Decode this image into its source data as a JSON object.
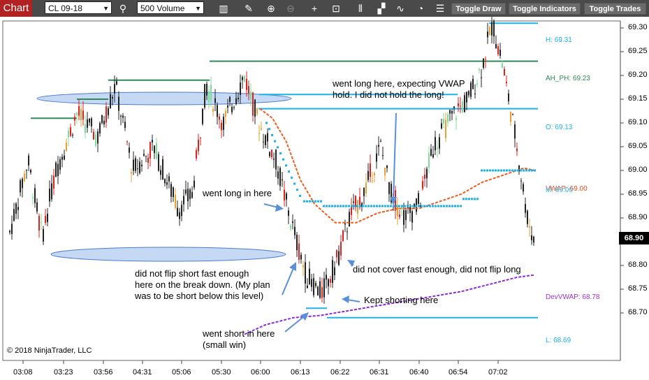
{
  "toolbar": {
    "title": "Chart",
    "instrument": "CL 09-18",
    "interval": "500 Volume",
    "buttons": [
      "Toggle Draw",
      "Toggle Indicators",
      "Toggle Trades"
    ],
    "icons": [
      "bars-icon",
      "pencil-icon",
      "zoom-in-icon",
      "zoom-out-icon",
      "crosshair-icon",
      "data-box-icon",
      "bar-type-icon",
      "drawing-tools-icon",
      "indicators-icon",
      "strategies-icon",
      "properties-icon"
    ]
  },
  "chart_data": {
    "type": "candlestick",
    "y_axis": {
      "range": [
        68.66,
        69.35
      ],
      "ticks": [
        "69.30",
        "69.25",
        "69.20",
        "69.15",
        "69.10",
        "69.05",
        "69.00",
        "68.95",
        "68.90",
        "68.85",
        "68.80",
        "68.75",
        "68.70"
      ]
    },
    "x_axis": {
      "ticks": [
        "03:08",
        "03:23",
        "03:56",
        "04:31",
        "05:06",
        "05:30",
        "06:00",
        "06:13",
        "06:22",
        "06:31",
        "06:40",
        "06:54",
        "07:02"
      ]
    },
    "last_price": "68.90",
    "price_lines": [
      {
        "label": "H: 69.31",
        "value": 69.31
      },
      {
        "label": "AH_PH: 69.23",
        "value": 69.23
      },
      {
        "label": "O: 69.13",
        "value": 69.13
      },
      {
        "label": "L: 68.69",
        "value": 68.69
      }
    ],
    "right_labels": [
      {
        "text": "VWAP: 69.00",
        "value": 69.0,
        "color": "#e05020"
      },
      {
        "text": "M: 69.00",
        "value": 68.995,
        "color": "#33bbee"
      },
      {
        "text": "DevVWAP: 68.78",
        "value": 68.78,
        "color": "#9933cc"
      }
    ]
  },
  "annotations": [
    "went long here, expecting VWAP",
    "hold. I did not hold the long!",
    "went long in here",
    "did not flip short fast enough",
    "here on the break down. (My plan",
    "was to be short below this level)",
    "did not cover fast enough, did not flip long",
    "Kept shorting here",
    "went short in here",
    "(small win)"
  ],
  "copyright": "© 2018 NinjaTrader, LLC",
  "colors": {
    "toolbar_bg": "#4a4a4a",
    "title_bg": "#b22222",
    "price_line": "#1ab2ea",
    "ah_line": "#2e8b57",
    "vwap": "#f05a1a",
    "dev_vwap": "#8a2be2",
    "ellipse": "#9ec0ef"
  }
}
